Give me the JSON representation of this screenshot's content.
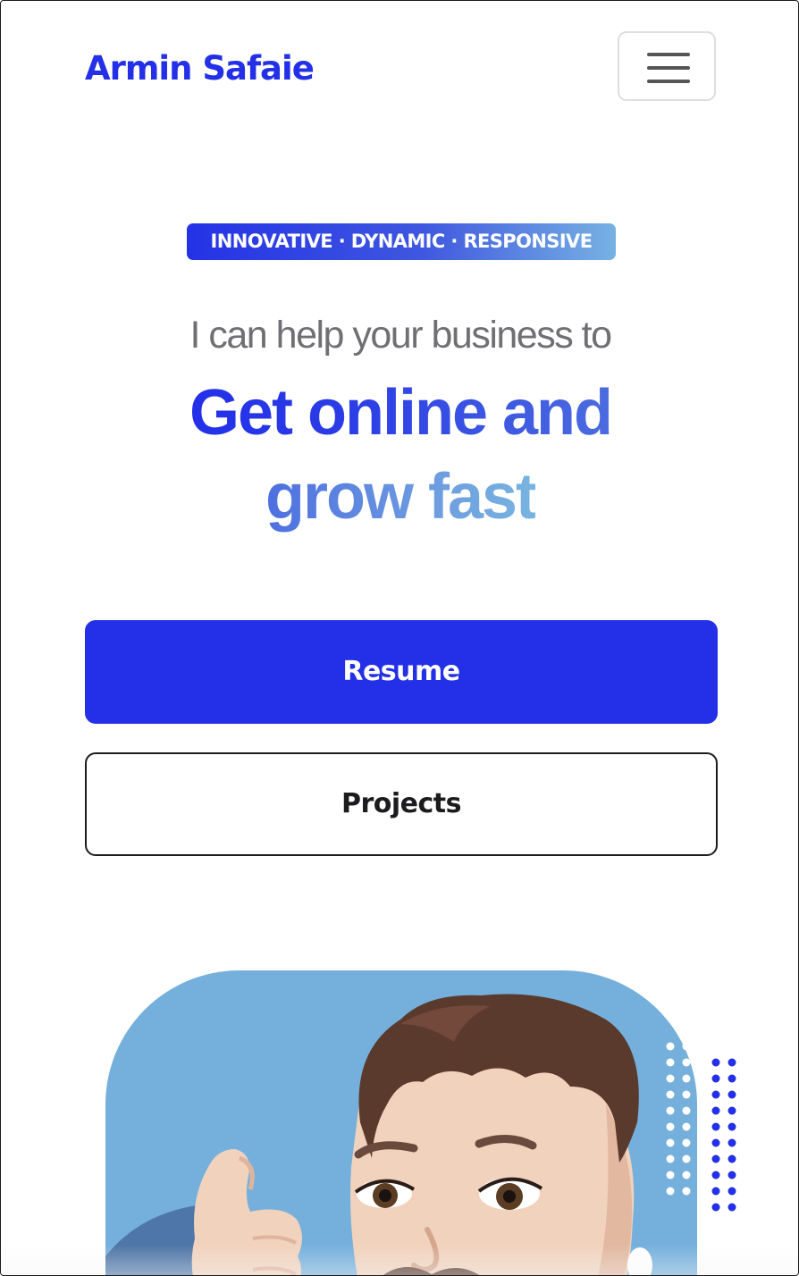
{
  "header": {
    "brand_name": "Armin Safaie",
    "menu_icon": "hamburger-menu-icon"
  },
  "hero": {
    "tagline": "INNOVATIVE · DYNAMIC · RESPONSIVE",
    "subheading": "I can help your business to",
    "headline_line1": "Get online and",
    "headline_line2": "grow fast"
  },
  "actions": {
    "primary_label": "Resume",
    "secondary_label": "Projects"
  },
  "avatar": {
    "description_icon": "memoji-thumbs-up-avatar"
  },
  "colors": {
    "accent": "#2330e8",
    "accent_light": "#78b4e0",
    "avatar_bg": "#75b0dc",
    "text_muted": "#6f6f74",
    "text_dark": "#1c1c1e"
  }
}
